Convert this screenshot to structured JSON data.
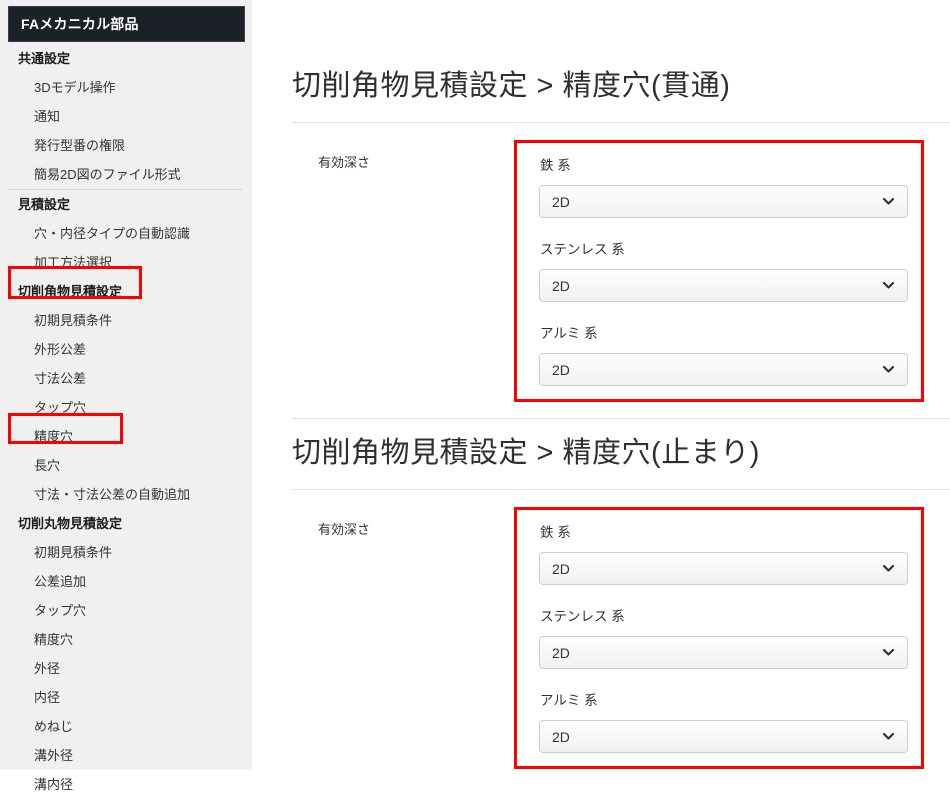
{
  "colors": {
    "annotation_red": "#ff0000",
    "sidebar_bg": "#f0f0f1",
    "app_header_bg": "#1c2127",
    "text": "#333333",
    "divider": "#e1e1e5"
  },
  "icons": {
    "select_indicator": "chevron-down-icon"
  },
  "sidebar": {
    "app_title": "FAメカニカル部品",
    "items": [
      {
        "label": "共通設定",
        "type": "group"
      },
      {
        "label": "3Dモデル操作",
        "type": "item"
      },
      {
        "label": "通知",
        "type": "item"
      },
      {
        "label": "発行型番の権限",
        "type": "item"
      },
      {
        "label": "簡易2D図のファイル形式",
        "type": "item"
      },
      {
        "label": "見積設定",
        "type": "group"
      },
      {
        "label": "穴・内径タイプの自動認識",
        "type": "item"
      },
      {
        "label": "加工方法選択",
        "type": "item"
      },
      {
        "label": "切削角物見積設定",
        "type": "group",
        "annotated": true
      },
      {
        "label": "初期見積条件",
        "type": "item"
      },
      {
        "label": "外形公差",
        "type": "item"
      },
      {
        "label": "寸法公差",
        "type": "item"
      },
      {
        "label": "タップ穴",
        "type": "item"
      },
      {
        "label": "精度穴",
        "type": "item",
        "annotated": true
      },
      {
        "label": "長穴",
        "type": "item"
      },
      {
        "label": "寸法・寸法公差の自動追加",
        "type": "item"
      },
      {
        "label": "切削丸物見積設定",
        "type": "group"
      },
      {
        "label": "初期見積条件",
        "type": "item"
      },
      {
        "label": "公差追加",
        "type": "item"
      },
      {
        "label": "タップ穴",
        "type": "item"
      },
      {
        "label": "精度穴",
        "type": "item"
      },
      {
        "label": "外径",
        "type": "item"
      },
      {
        "label": "内径",
        "type": "item"
      },
      {
        "label": "めねじ",
        "type": "item"
      },
      {
        "label": "溝外径",
        "type": "item"
      },
      {
        "label": "溝内径",
        "type": "item",
        "partially_visible": true
      }
    ]
  },
  "main": {
    "sections": [
      {
        "title": "切削角物見積設定 > 精度穴(貫通)",
        "row_label": "有効深さ",
        "fields": [
          {
            "label": "鉄 系",
            "value": "2D"
          },
          {
            "label": "ステンレス 系",
            "value": "2D"
          },
          {
            "label": "アルミ 系",
            "value": "2D"
          }
        ]
      },
      {
        "title": "切削角物見積設定 > 精度穴(止まり)",
        "row_label": "有効深さ",
        "fields": [
          {
            "label": "鉄 系",
            "value": "2D"
          },
          {
            "label": "ステンレス 系",
            "value": "2D"
          },
          {
            "label": "アルミ 系",
            "value": "2D"
          }
        ]
      }
    ]
  }
}
